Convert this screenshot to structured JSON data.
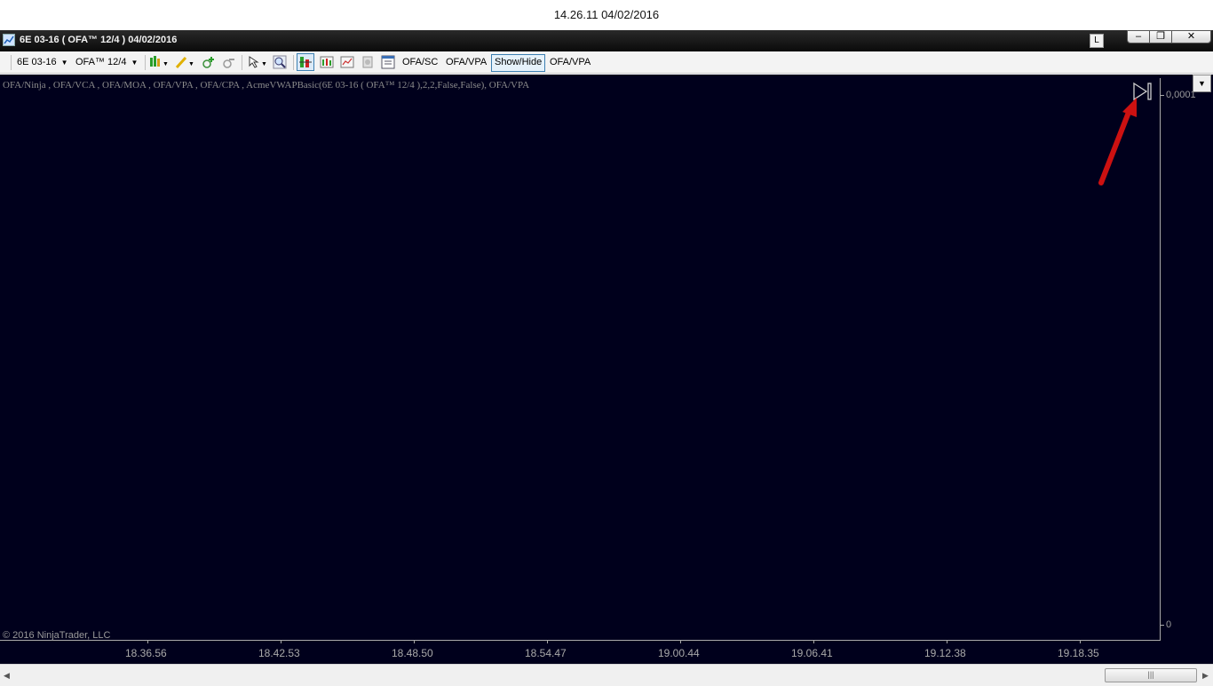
{
  "screen_caption": "14.26.11 04/02/2016",
  "window": {
    "title": "6E 03-16 ( OFA™ 12/4 )  04/02/2016",
    "l_button": "L",
    "minimize_icon": "‒",
    "maximize_icon": "❐",
    "close_icon": "✕"
  },
  "toolbar": {
    "instrument": "6E 03-16",
    "period": "OFA™ 12/4",
    "buttons": [
      "OFA/SC",
      "OFA/VPA",
      "Show/Hide",
      "OFA/VPA"
    ],
    "icons": [
      "candlestick-icon",
      "pencil-icon",
      "zoom-in-icon",
      "zoom-out-icon",
      "cursor-icon",
      "magnifier-icon",
      "bars-icon",
      "chart-icon",
      "data-box-icon",
      "camera-icon",
      "properties-icon"
    ]
  },
  "chart": {
    "indicators_text": "OFA/Ninja , OFA/VCA , OFA/MOA , OFA/VPA , OFA/CPA , AcmeVWAPBasic(6E 03-16 ( OFA™ 12/4 ),2,2,False,False), OFA/VPA",
    "y_top_label": "0,0001",
    "y_bottom_label": "0",
    "copyright": "© 2016 NinjaTrader, LLC",
    "x_labels": [
      "18.36.56",
      "18.42.53",
      "18.48.50",
      "18.54.47",
      "19.00.44",
      "19.06.41",
      "19.12.38",
      "19.18.35"
    ],
    "background_color": "#00001c",
    "annotation_color": "#cc1111"
  },
  "scrollbar": {
    "left_arrow": "◀",
    "right_arrow": "▶",
    "grip": "|||"
  }
}
